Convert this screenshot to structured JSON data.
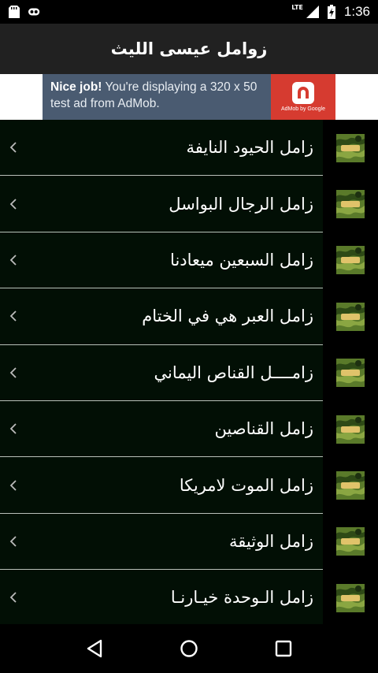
{
  "status_bar": {
    "network": "LTE",
    "time": "1:36",
    "icons": [
      "sd-card-icon",
      "ringtone-icon",
      "signal-icon",
      "battery-charging-icon"
    ]
  },
  "app_bar": {
    "title": "زوامل عيسى الليث"
  },
  "ad": {
    "headline": "Nice job!",
    "body": " You're displaying a 320 x 50 test ad from AdMob.",
    "logo_text": "AdMob by Google",
    "colors": {
      "banner": "#4a5b71",
      "logo": "#d63b30"
    }
  },
  "list": {
    "items": [
      {
        "label": "زامل الحيود النايفة"
      },
      {
        "label": "زامل الرجال البواسل"
      },
      {
        "label": "زامل السبعين ميعادنا"
      },
      {
        "label": "زامل العبر هي في الختام"
      },
      {
        "label": "زامــــل القناص اليماني"
      },
      {
        "label": "زامل القناصين"
      },
      {
        "label": "زامل الموت لامريكا"
      },
      {
        "label": "زامل الوثيقة"
      },
      {
        "label": "زامل الـوحدة خيـارنـا"
      }
    ],
    "item_icon": "chevron-left-icon",
    "thumb_icon": "camouflage-thumbnail"
  },
  "nav_bar": {
    "buttons": [
      "back-icon",
      "home-icon",
      "recents-icon"
    ]
  }
}
